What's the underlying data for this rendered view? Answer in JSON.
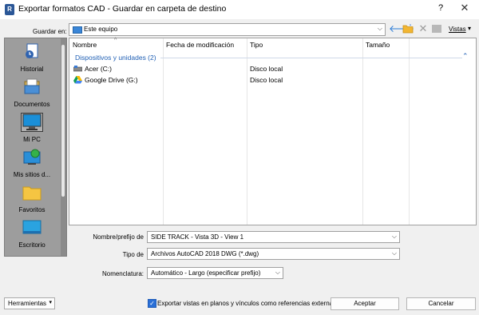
{
  "window": {
    "title": "Exportar formatos CAD - Guardar en carpeta de destino",
    "help": "?",
    "close": "✕"
  },
  "save_in": {
    "label": "Guardar en:",
    "value": "Este equipo"
  },
  "toolbar": {
    "views_label": "Vistas",
    "back_icon": "back-arrow-icon",
    "new_folder_icon": "new-folder-icon",
    "delete_icon": "delete-icon"
  },
  "places": [
    {
      "label": "Historial",
      "icon": "history-icon"
    },
    {
      "label": "Documentos",
      "icon": "documents-icon"
    },
    {
      "label": "Mi PC",
      "icon": "computer-icon"
    },
    {
      "label": "Mis sitios d...",
      "icon": "network-sites-icon"
    },
    {
      "label": "Favoritos",
      "icon": "favorites-folder-icon"
    },
    {
      "label": "Escritorio",
      "icon": "desktop-icon"
    }
  ],
  "file_list": {
    "columns": [
      "Nombre",
      "Fecha de modificación",
      "Tipo",
      "Tamaño"
    ],
    "group": "Dispositivos y unidades (2)",
    "rows": [
      {
        "name": "Acer (C:)",
        "type": "Disco local"
      },
      {
        "name": "Google Drive (G:)",
        "type": "Disco local"
      }
    ]
  },
  "form": {
    "name_label": "Nombre/prefijo de",
    "name_value": "SIDE TRACK - Vista 3D - View 1",
    "type_label": "Tipo de",
    "type_value": "Archivos AutoCAD 2018 DWG (*.dwg)",
    "naming_label": "Nomenclatura:",
    "naming_value": "Automático - Largo (especificar prefijo)"
  },
  "bottom": {
    "tools_label": "Herramientas",
    "checkbox_label": "Exportar vistas en planos y vínculos como referencias externas",
    "checkbox_checked": true,
    "accept_label": "Aceptar",
    "cancel_label": "Cancelar"
  },
  "colors": {
    "accent": "#2a6fd6",
    "group_header": "#1f5fb4",
    "sidebar": "#9d9d9d"
  }
}
